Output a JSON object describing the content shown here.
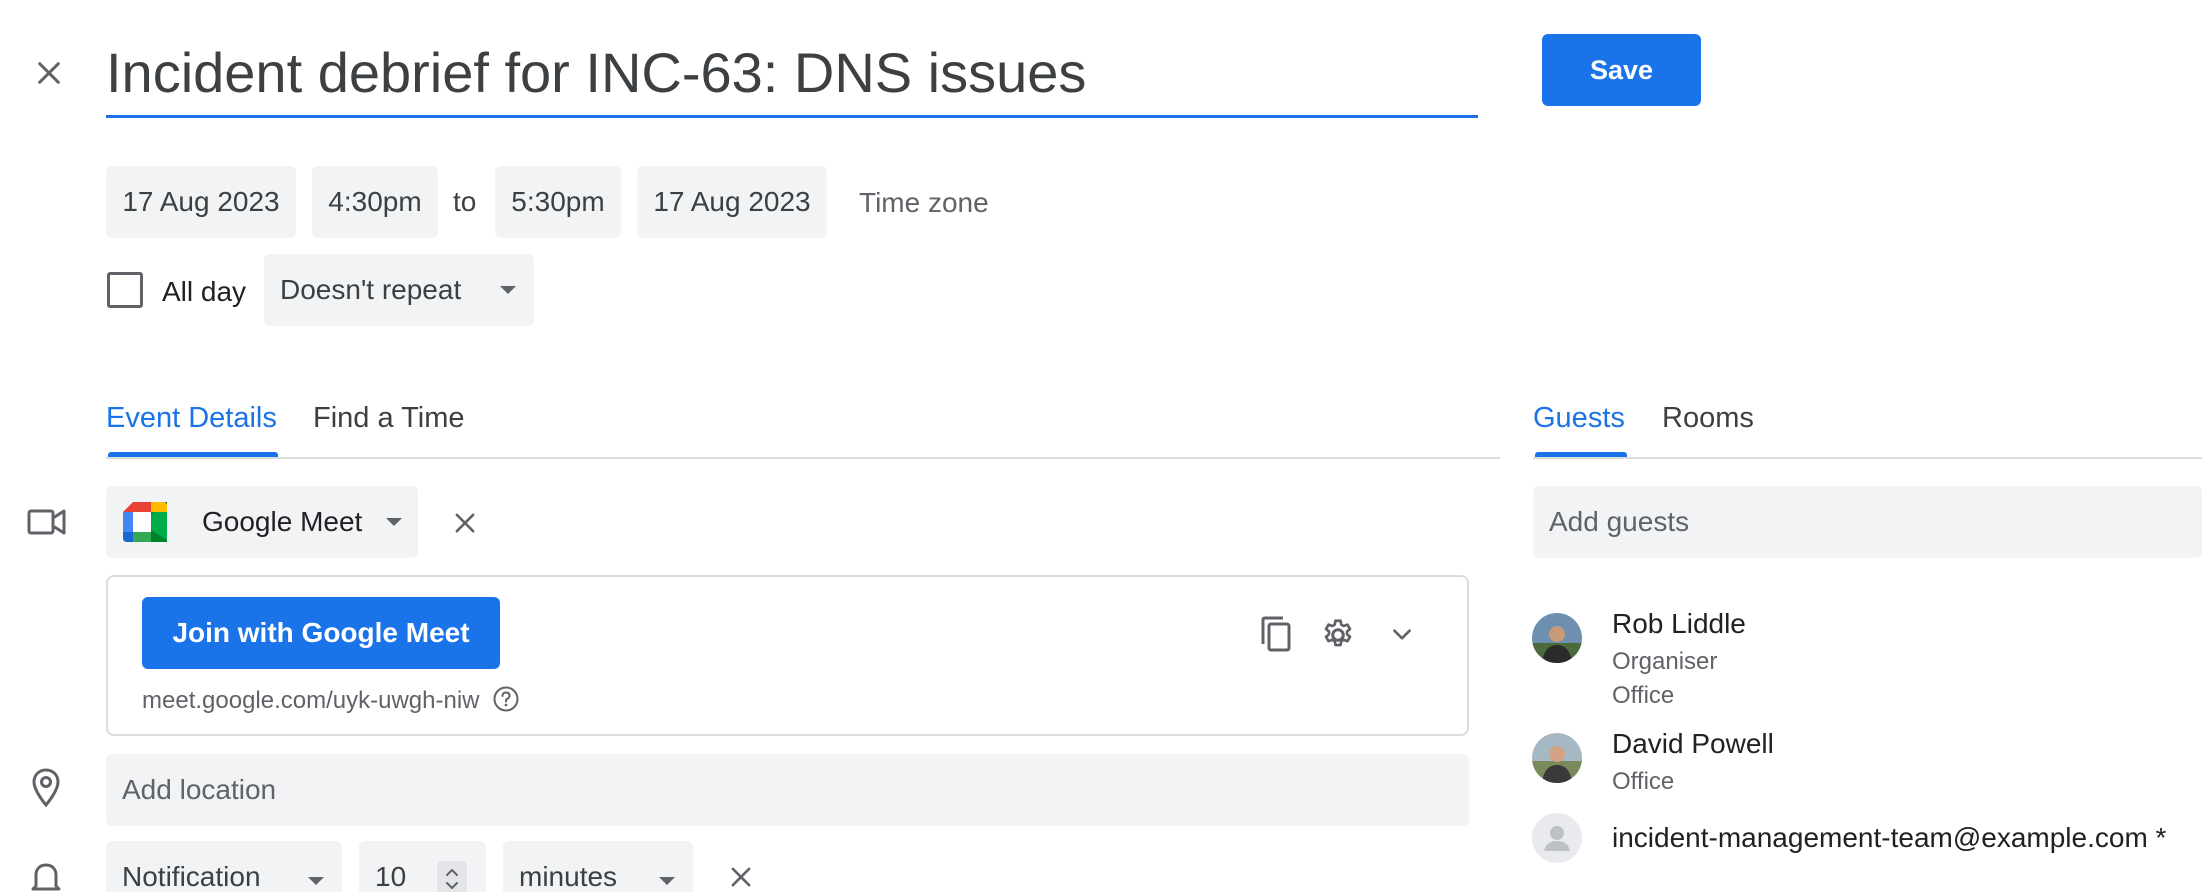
{
  "event": {
    "title": "Incident debrief for INC-63: DNS issues",
    "save_label": "Save"
  },
  "datetime": {
    "start_date": "17 Aug 2023",
    "start_time": "4:30pm",
    "to_label": "to",
    "end_time": "5:30pm",
    "end_date": "17 Aug 2023",
    "timezone_label": "Time zone",
    "all_day_label": "All day",
    "all_day_checked": false,
    "repeat_value": "Doesn't repeat"
  },
  "tabs": {
    "left": [
      {
        "label": "Event Details",
        "active": true
      },
      {
        "label": "Find a Time",
        "active": false
      }
    ],
    "right": [
      {
        "label": "Guests",
        "active": true
      },
      {
        "label": "Rooms",
        "active": false
      }
    ]
  },
  "conference": {
    "provider": "Google Meet",
    "join_label": "Join with Google Meet",
    "link": "meet.google.com/uyk-uwgh-niw"
  },
  "location": {
    "placeholder": "Add location"
  },
  "notification": {
    "type": "Notification",
    "amount": "10",
    "unit": "minutes"
  },
  "guests": {
    "placeholder": "Add guests",
    "list": [
      {
        "name": "Rob Liddle",
        "role": "Organiser",
        "location": "Office"
      },
      {
        "name": "David Powell",
        "role": "",
        "location": "Office"
      },
      {
        "name": "incident-management-team@example.com *",
        "role": "",
        "location": ""
      }
    ]
  },
  "colors": {
    "accent": "#1a73e8",
    "field_bg": "#f1f3f4",
    "text": "#3c4043",
    "muted": "#5f6368"
  }
}
